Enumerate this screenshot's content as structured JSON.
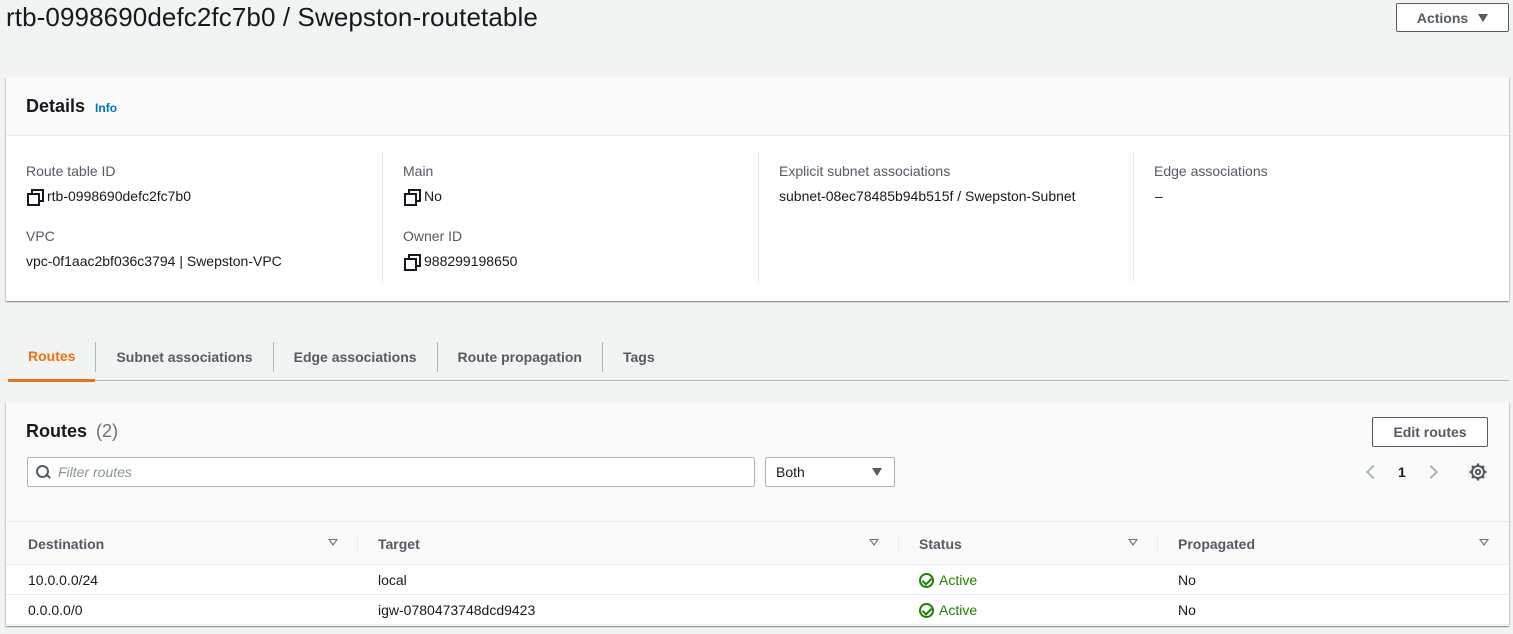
{
  "page": {
    "title": "rtb-0998690defc2fc7b0 / Swepston-routetable",
    "actions_label": "Actions"
  },
  "details": {
    "title": "Details",
    "info_label": "Info",
    "route_table_id": {
      "label": "Route table ID",
      "value": "rtb-0998690defc2fc7b0"
    },
    "vpc": {
      "label": "VPC",
      "value": "vpc-0f1aac2bf036c3794 | Swepston-VPC"
    },
    "main": {
      "label": "Main",
      "value": "No"
    },
    "owner_id": {
      "label": "Owner ID",
      "value": "988299198650"
    },
    "explicit_subnet": {
      "label": "Explicit subnet associations",
      "value": "subnet-08ec78485b94b515f / Swepston-Subnet"
    },
    "edge_assoc": {
      "label": "Edge associations",
      "value": "–"
    }
  },
  "tabs": [
    {
      "label": "Routes",
      "active": true
    },
    {
      "label": "Subnet associations",
      "active": false
    },
    {
      "label": "Edge associations",
      "active": false
    },
    {
      "label": "Route propagation",
      "active": false
    },
    {
      "label": "Tags",
      "active": false
    }
  ],
  "routes": {
    "title": "Routes",
    "count": "(2)",
    "edit_label": "Edit routes",
    "filter_placeholder": "Filter routes",
    "select_value": "Both",
    "page_number": "1",
    "columns": [
      "Destination",
      "Target",
      "Status",
      "Propagated"
    ],
    "rows": [
      {
        "destination": "10.0.0.0/24",
        "target": "local",
        "target_is_link": false,
        "status": "Active",
        "propagated": "No"
      },
      {
        "destination": "0.0.0.0/0",
        "target": "igw-0780473748dcd9423",
        "target_is_link": true,
        "status": "Active",
        "propagated": "No"
      }
    ]
  },
  "colors": {
    "link": "#0073bb",
    "active_tab": "#ec7211",
    "status_active": "#1d8102"
  },
  "icons": [
    "copy-icon",
    "search-icon",
    "chevron-left-icon",
    "chevron-right-icon",
    "gear-icon",
    "sort-icon",
    "check-circle-icon",
    "caret-down-icon"
  ]
}
